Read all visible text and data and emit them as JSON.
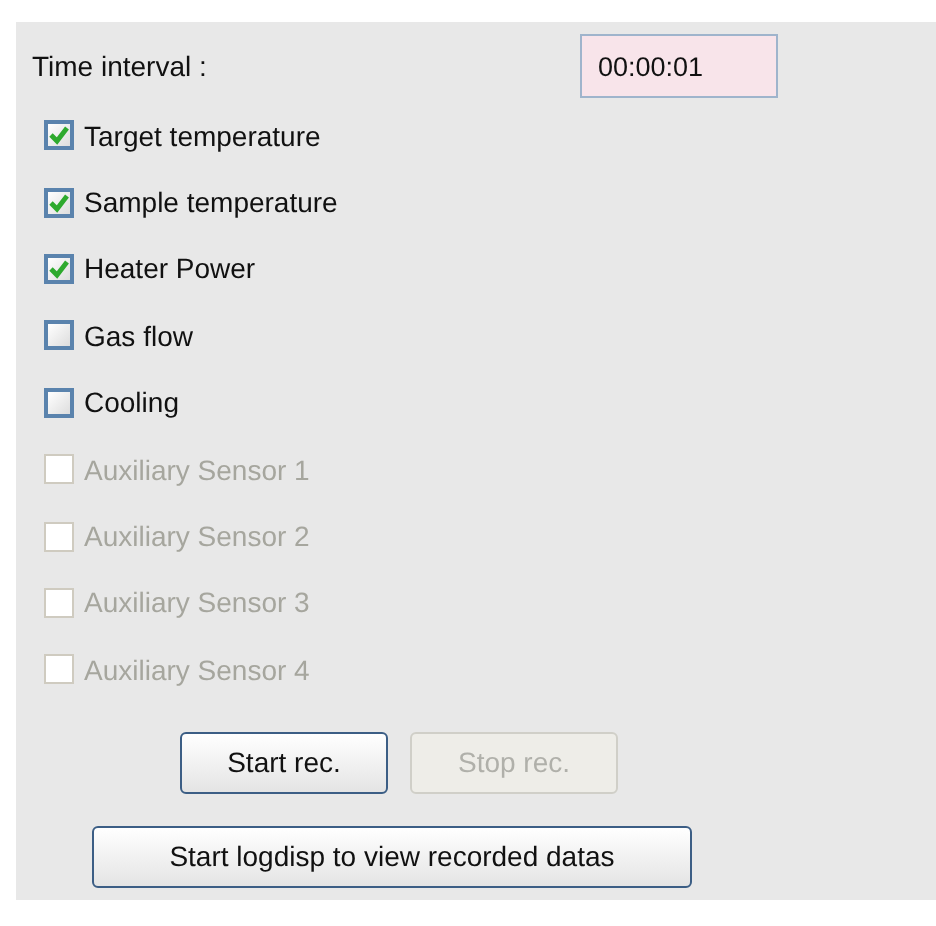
{
  "time_interval": {
    "label": "Time interval :",
    "value": "00:00:01"
  },
  "channels": [
    {
      "label": "Target temperature",
      "checked": true,
      "disabled": false
    },
    {
      "label": "Sample temperature",
      "checked": true,
      "disabled": false
    },
    {
      "label": "Heater Power",
      "checked": true,
      "disabled": false
    },
    {
      "label": "Gas flow",
      "checked": false,
      "disabled": false
    },
    {
      "label": "Cooling",
      "checked": false,
      "disabled": false
    },
    {
      "label": "Auxiliary Sensor 1",
      "checked": false,
      "disabled": true
    },
    {
      "label": "Auxiliary Sensor 2",
      "checked": false,
      "disabled": true
    },
    {
      "label": "Auxiliary Sensor 3",
      "checked": false,
      "disabled": true
    },
    {
      "label": "Auxiliary Sensor 4",
      "checked": false,
      "disabled": true
    }
  ],
  "record_buttons": [
    {
      "label": "Start rec.",
      "disabled": false
    },
    {
      "label": "Stop rec.",
      "disabled": true
    }
  ],
  "logdisp_button": {
    "label": "Start logdisp to view recorded datas"
  }
}
